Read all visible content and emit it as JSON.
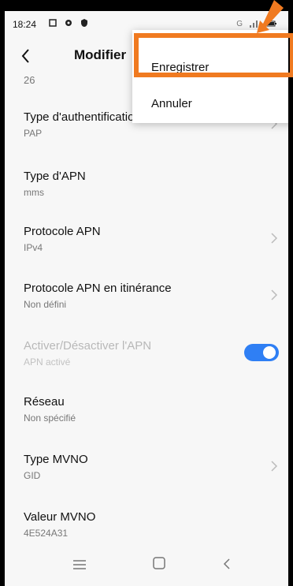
{
  "status_bar": {
    "time": "18:24",
    "network_label": "G"
  },
  "header": {
    "title": "Modifier"
  },
  "top_value": "26",
  "settings": [
    {
      "title": "Type d'authentification",
      "value": "PAP",
      "has_chevron": true
    },
    {
      "title": "Type d'APN",
      "value": "mms",
      "has_chevron": false
    },
    {
      "title": "Protocole APN",
      "value": "IPv4",
      "has_chevron": true
    },
    {
      "title": "Protocole APN en itinérance",
      "value": "Non défini",
      "has_chevron": true
    },
    {
      "title": "Activer/Désactiver l'APN",
      "value": "APN activé",
      "toggle_on": true,
      "disabled": true
    },
    {
      "title": "Réseau",
      "value": "Non spécifié",
      "has_chevron": false
    },
    {
      "title": "Type MVNO",
      "value": "GID",
      "has_chevron": true
    },
    {
      "title": "Valeur MVNO",
      "value": "4E524A31",
      "has_chevron": false
    }
  ],
  "popup_menu": {
    "items": [
      "Enregistrer",
      "Annuler"
    ]
  },
  "colors": {
    "accent": "#2f7ff4",
    "highlight": "#f07a20"
  }
}
